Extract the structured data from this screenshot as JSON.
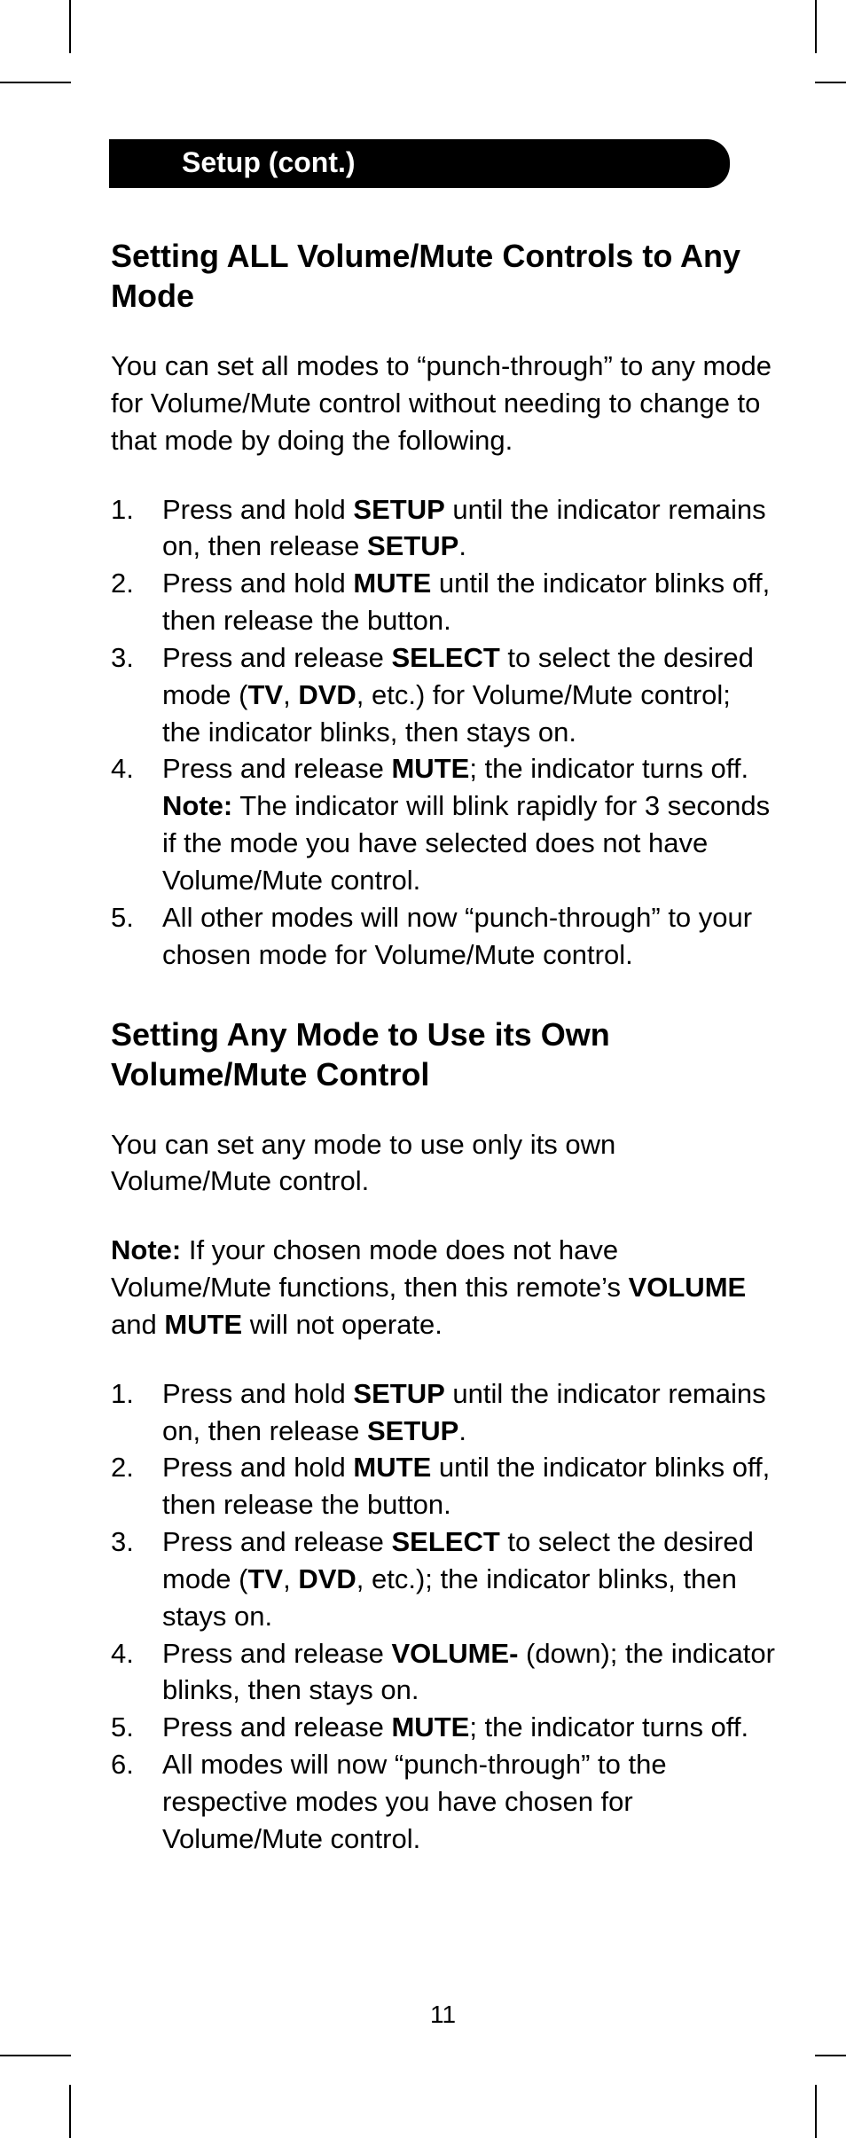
{
  "tab_label": "Setup (cont.)",
  "section1": {
    "heading": "Setting ALL Volume/Mute Controls to Any Mode",
    "intro": "You can set all modes to “punch-through” to any mode for Volume/Mute control without needing to change to that mode by doing the following.",
    "steps_html": [
      "Press and hold <b>SETUP</b> until the indicator remains on, then release <b>SETUP</b>.",
      "Press and hold <b>MUTE</b> until the indicator blinks off, then release the button.",
      "Press and release <b>SELECT</b> to select the desired mode (<b>TV</b>, <b>DVD</b>, etc.) for Volume/Mute control; the indicator blinks, then stays on.",
      "Press and release <b>MUTE</b>; the indicator turns off. <b>Note:</b> The indicator will blink rapidly for 3 seconds if the mode you have selected does not have Volume/Mute control.",
      "All other modes will now “punch-through” to your chosen mode for Volume/Mute control."
    ]
  },
  "section2": {
    "heading": "Setting Any Mode to Use its Own Volume/Mute Control",
    "intro": "You can set any mode to use only its own Volume/Mute control.",
    "note_html": "<b>Note:</b> If your chosen mode does not have Volume/Mute functions, then this remote’s <b>VOLUME</b> and <b>MUTE</b> will not operate.",
    "steps_html": [
      "Press and hold <b>SETUP</b> until the indicator remains on, then release <b>SETUP</b>.",
      "Press and hold <b>MUTE</b> until the indicator blinks off, then release the button.",
      "Press and release <b>SELECT</b> to select the desired mode (<b>TV</b>, <b>DVD</b>, etc.); the indicator blinks, then stays on.",
      "Press and release <b>VOLUME-</b> (down); the indicator blinks, then stays on.",
      "Press and release <b>MUTE</b>; the indicator turns off.",
      "All modes will now “punch-through” to the respective modes you have chosen for Volume/Mute control."
    ]
  },
  "page_number": "11"
}
